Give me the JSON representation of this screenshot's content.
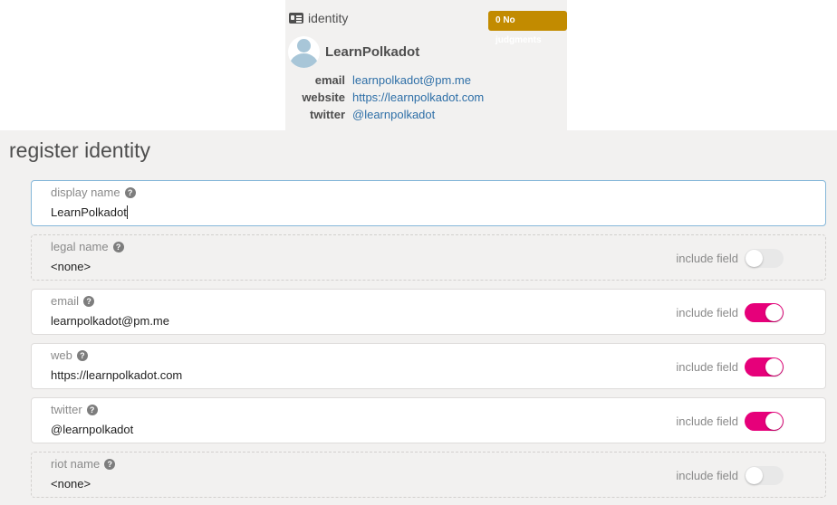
{
  "identity_card": {
    "header_label": "identity",
    "badge": "0 No judgments",
    "account_name": "LearnPolkadot",
    "rows": [
      {
        "label": "email",
        "value": "learnpolkadot@pm.me"
      },
      {
        "label": "website",
        "value": "https://learnpolkadot.com"
      },
      {
        "label": "twitter",
        "value": "@learnpolkadot"
      }
    ]
  },
  "form": {
    "title": "register identity",
    "include_label": "include field",
    "fields": [
      {
        "label": "display name",
        "value": "LearnPolkadot",
        "include": null
      },
      {
        "label": "legal name",
        "value": "<none>",
        "include": false
      },
      {
        "label": "email",
        "value": "learnpolkadot@pm.me",
        "include": true
      },
      {
        "label": "web",
        "value": "https://learnpolkadot.com",
        "include": true
      },
      {
        "label": "twitter",
        "value": "@learnpolkadot",
        "include": true
      },
      {
        "label": "riot name",
        "value": "<none>",
        "include": false
      }
    ]
  },
  "colors": {
    "accent": "#e6007a",
    "badge": "#c28b00",
    "link": "#2e6fa7"
  }
}
